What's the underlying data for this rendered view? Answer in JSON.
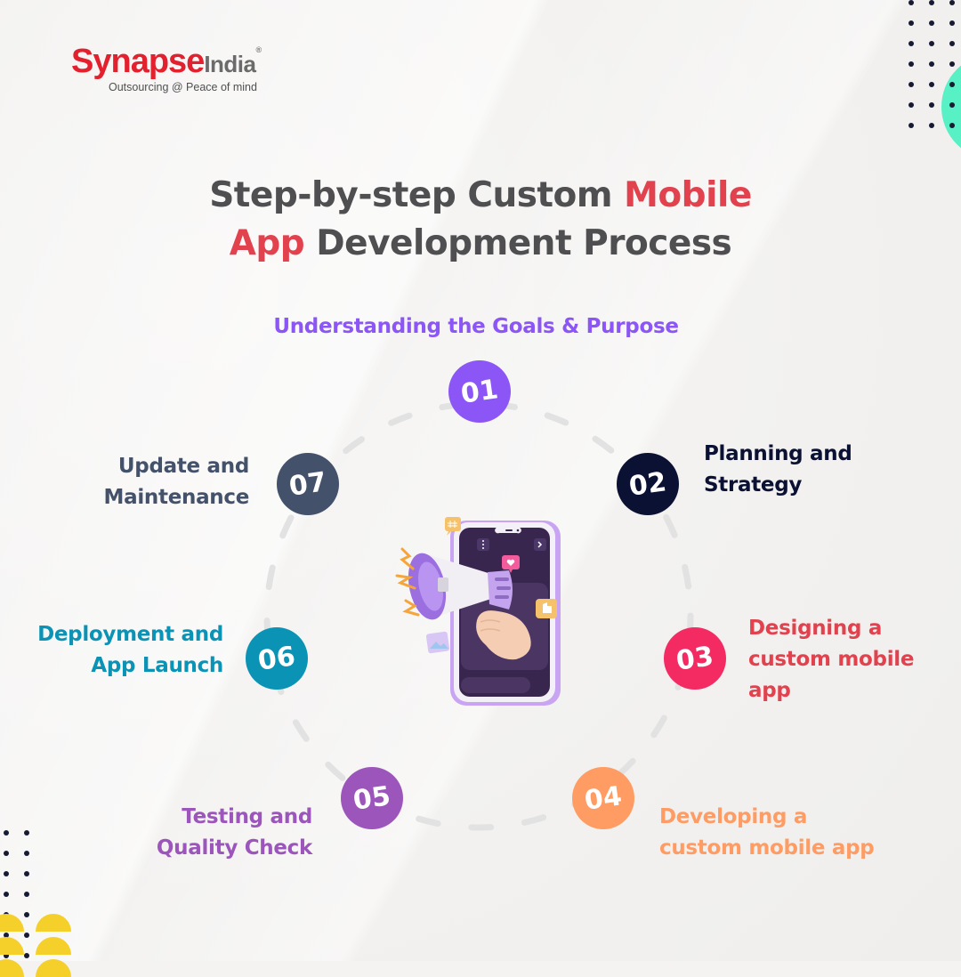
{
  "brand": {
    "name_primary": "Synapse",
    "name_secondary": "India",
    "registered_mark": "®",
    "tagline": "Outsourcing @ Peace of mind",
    "colors": {
      "primary": "#e3202e",
      "secondary": "#6b6b6b"
    }
  },
  "title": {
    "line1_part1": "Step-by-step Custom ",
    "line1_accent": "Mobile",
    "line2_accent": "App",
    "line2_part2": " Development Process",
    "color": "#4f4f52",
    "accent_color": "#e2414e"
  },
  "steps": [
    {
      "number": "01",
      "label_lines": [
        "Understanding the Goals & Purpose"
      ],
      "badge_color": "#8c55f5",
      "label_color": "#8c55f5"
    },
    {
      "number": "02",
      "label_lines": [
        "Planning and",
        "Strategy"
      ],
      "badge_color": "#0b1133",
      "label_color": "#0b1133"
    },
    {
      "number": "03",
      "label_lines": [
        "Designing a",
        "custom mobile",
        "app"
      ],
      "badge_color": "#f42a63",
      "label_color": "#e2414e"
    },
    {
      "number": "04",
      "label_lines": [
        "Developing a",
        "custom mobile app"
      ],
      "badge_color": "#ff9c63",
      "label_color": "#ff9c63"
    },
    {
      "number": "05",
      "label_lines": [
        "Testing and",
        "Quality Check"
      ],
      "badge_color": "#9b55bb",
      "label_color": "#9b55bb"
    },
    {
      "number": "06",
      "label_lines": [
        "Deployment and",
        "App Launch"
      ],
      "badge_color": "#0b93b6",
      "label_color": "#0b93b6"
    },
    {
      "number": "07",
      "label_lines": [
        "Update and",
        "Maintenance"
      ],
      "badge_color": "#44516b",
      "label_color": "#44516b"
    }
  ],
  "illustration": {
    "description": "phone-with-megaphone",
    "icons": [
      "hashtag-bubble-icon",
      "heart-bubble-icon",
      "thumbs-up-bubble-icon",
      "image-card-icon",
      "menu-dots-icon",
      "chevron-right-icon"
    ]
  },
  "decor": {
    "dot_color": "#161a33",
    "mint_color": "#58f0c5",
    "yellow_color": "#f5cf2a",
    "ring_color": "#e2e2e2"
  }
}
